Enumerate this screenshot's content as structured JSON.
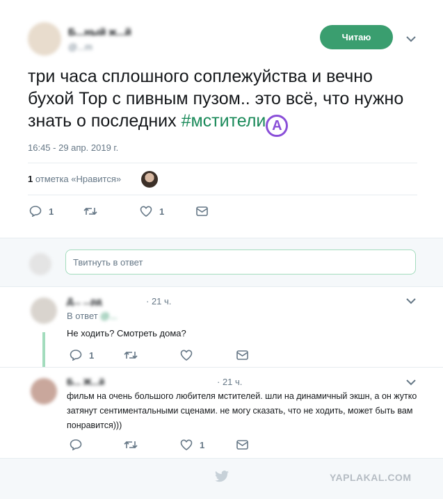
{
  "tweet": {
    "author_name": "Б...ный ж...й",
    "author_handle": "@...m",
    "follow_button_label": "Читаю",
    "text": "три часа сплошного соплежуйства и вечно бухой Тор с пивным пузом.. это всё, что нужно знать о последних",
    "hashtag": "#мстители",
    "hashtag_emoji": "A",
    "timestamp": "16:45 - 29 апр. 2019 г.",
    "likes_count_label": "1",
    "likes_text": "отметка «Нравится»",
    "reply_count": "1",
    "like_count": "1"
  },
  "reply_box": {
    "placeholder": "Твитнуть в ответ"
  },
  "replies": [
    {
      "author_blurred": "Д... ...рд",
      "time": "· 21 ч.",
      "reply_to_label": "В ответ",
      "reply_to_handle": "@...",
      "text": "Не ходить? Смотреть дома?",
      "reply_count": "1",
      "like_count": ""
    },
    {
      "author_blurred": "Б... Ж...й",
      "time": "· 21 ч.",
      "text": "фильм на очень большого любителя мстителей. шли на динамичный экшн, а он жутко затянут сентиментальными сценами. не могу сказать, что не ходить, может быть вам понравится)))",
      "reply_count": "",
      "like_count": "1"
    }
  ],
  "watermark": "YAPLAKAL.COM",
  "colors": {
    "accent": "#17bf63",
    "hashtag": "#1b8a5a",
    "button": "#3a9e6f",
    "emoji": "#8a4fd8",
    "panel_bg": "#f5f8fa",
    "divider": "#e6ecf0",
    "muted": "#657786"
  }
}
